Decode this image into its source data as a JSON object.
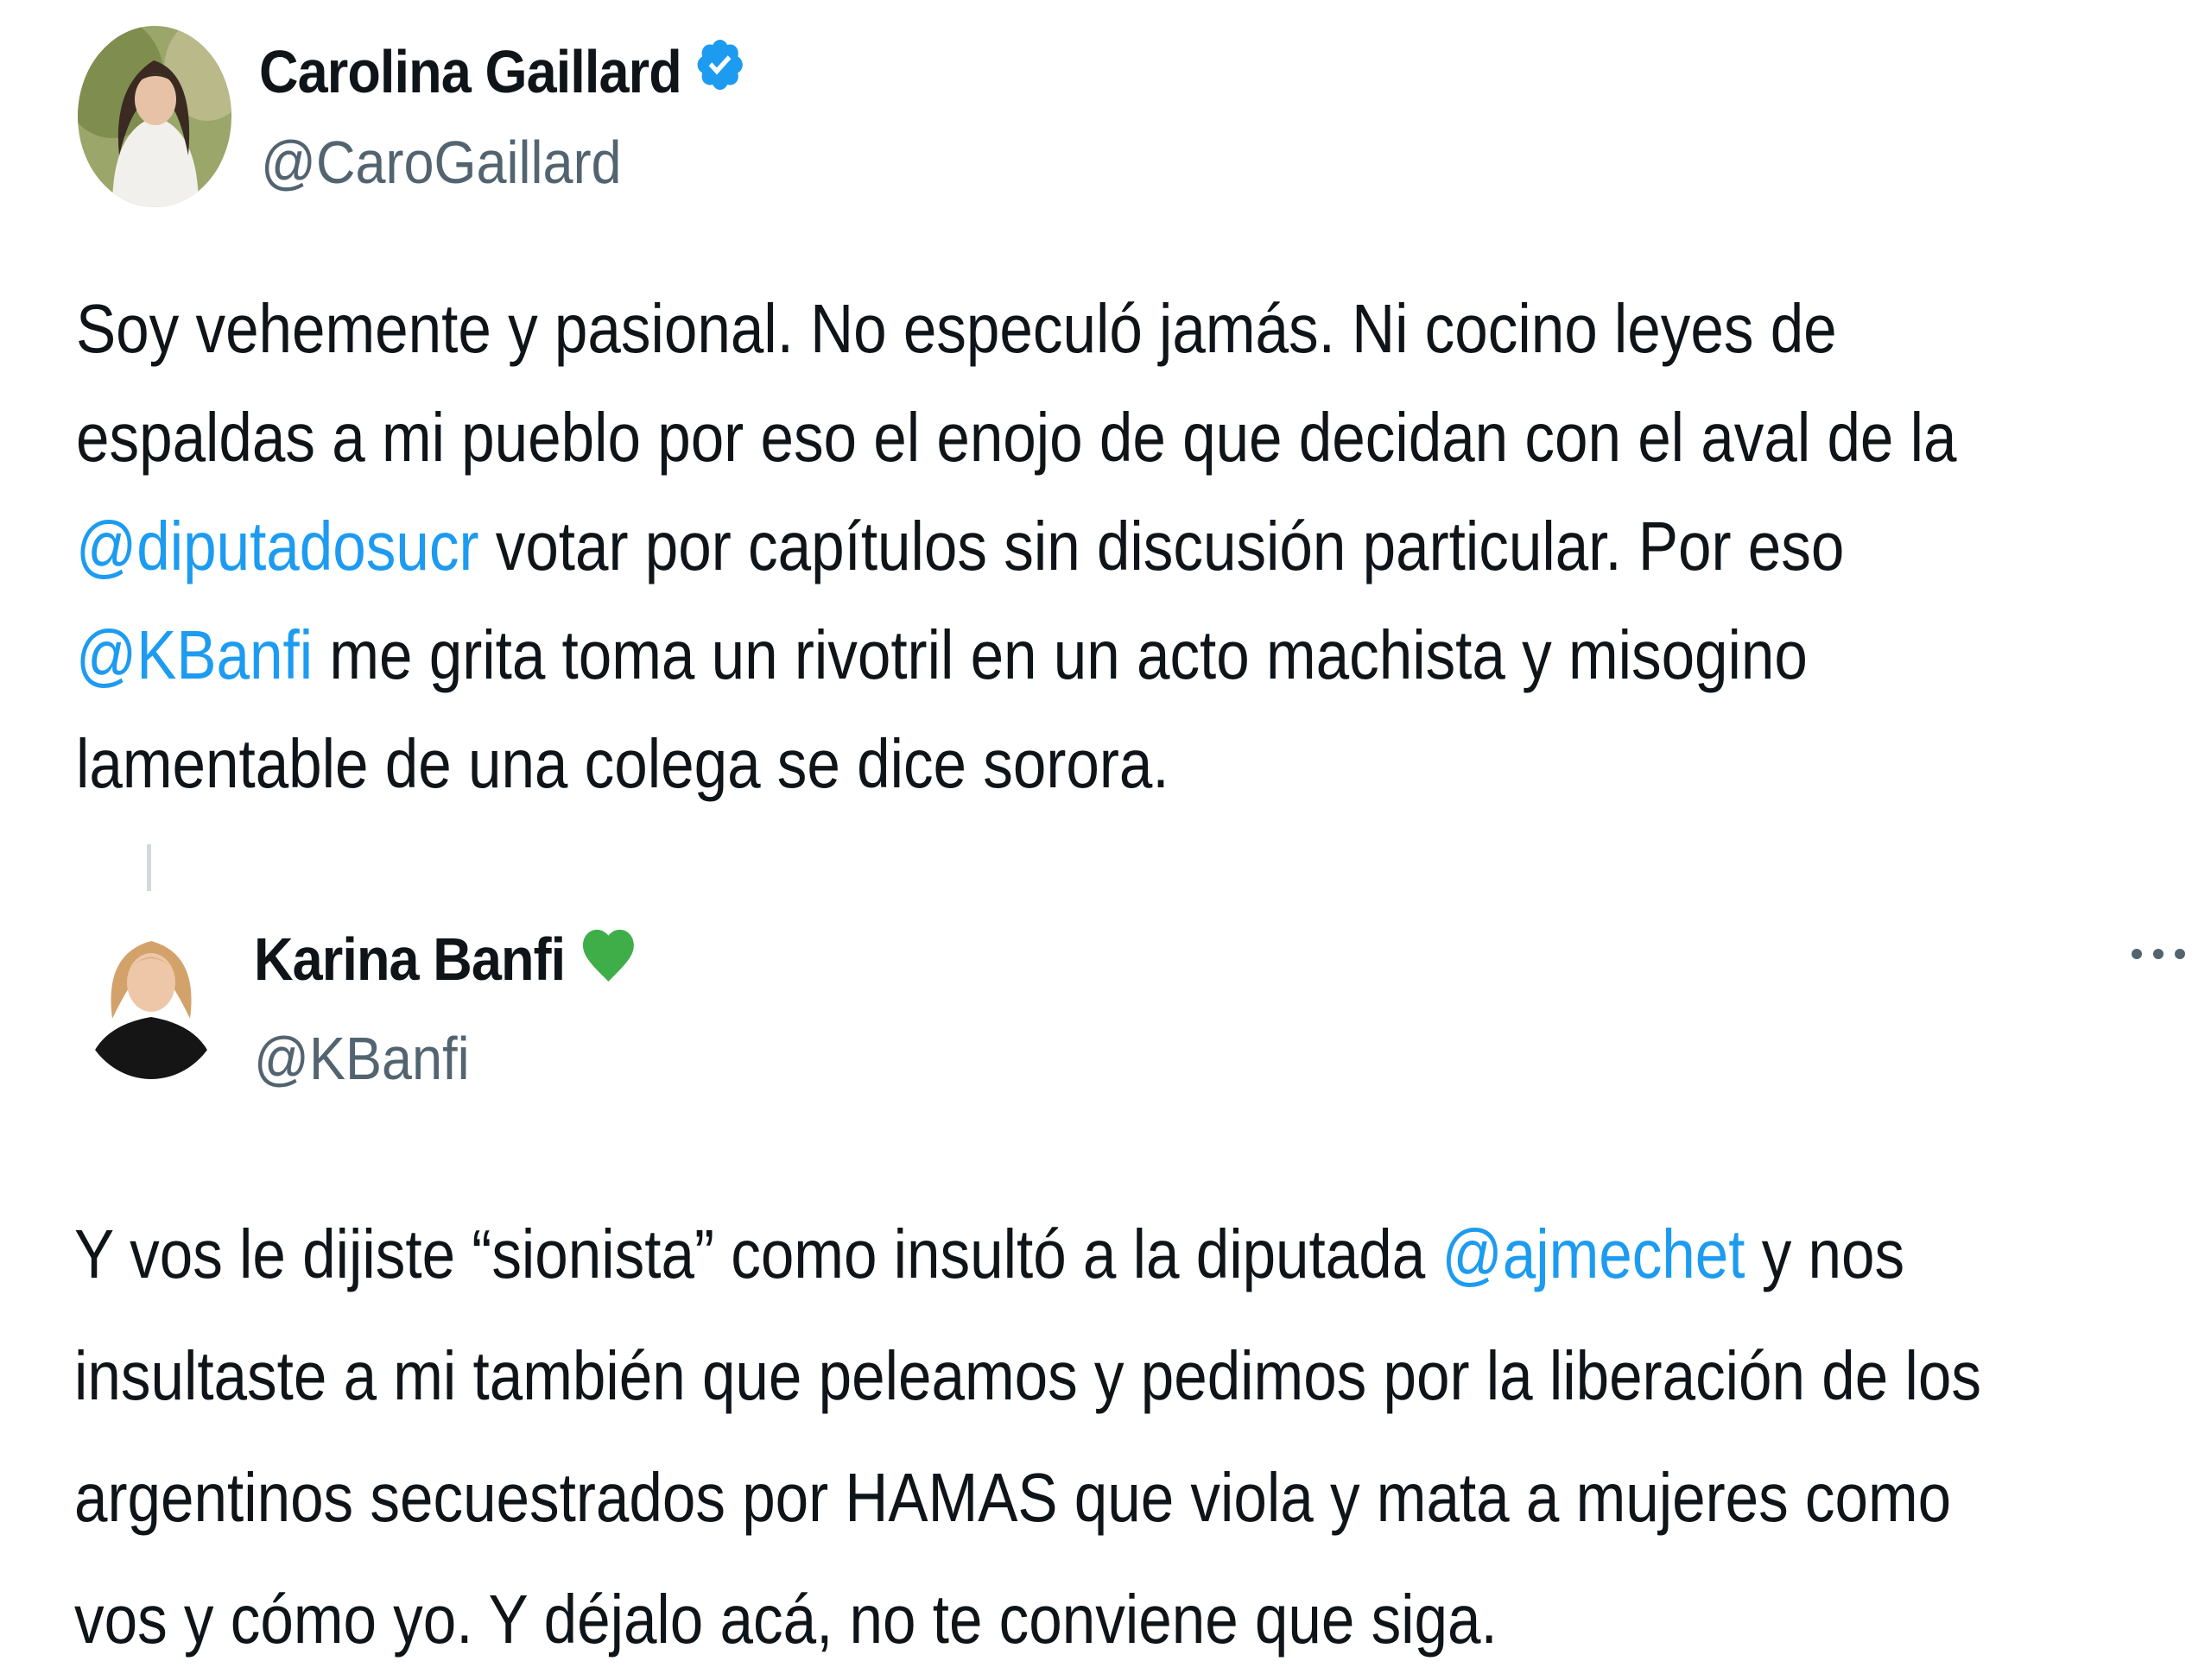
{
  "tweet1": {
    "display_name": "Carolina Gaillard",
    "handle": "@CaroGaillard",
    "badge": "verified-badge-icon",
    "lines": [
      [
        {
          "t": "Soy vehemente y pasional. No especuló jamás. Ni cocino leyes de"
        }
      ],
      [
        {
          "t": "espaldas a mi pueblo por eso el enojo de que decidan con el aval de la"
        }
      ],
      [
        {
          "t": "@diputadosucr",
          "m": true
        },
        {
          "t": " votar por capítulos sin discusión particular. Por eso"
        }
      ],
      [
        {
          "t": "@KBanfi",
          "m": true
        },
        {
          "t": " me grita toma un rivotril en un acto machista y misogino"
        }
      ],
      [
        {
          "t": "lamentable de una colega se dice sorora."
        }
      ]
    ]
  },
  "tweet2": {
    "display_name": "Karina Banfi",
    "handle": "@KBanfi",
    "badge": "green-heart-icon",
    "more": "more-options-icon",
    "lines": [
      [
        {
          "t": "Y vos le dijiste “sionista” como insultó a la diputada "
        },
        {
          "t": "@ajmechet",
          "m": true
        },
        {
          "t": " y nos"
        }
      ],
      [
        {
          "t": "insultaste a mi también que peleamos y pedimos por la liberación de los"
        }
      ],
      [
        {
          "t": "argentinos secuestrados por HAMAS que viola y mata a mujeres como"
        }
      ],
      [
        {
          "t": "vos y cómo yo. Y déjalo acá, no te conviene que siga."
        }
      ]
    ]
  },
  "colors": {
    "mention": "#1d9bf0",
    "verified": "#1d9bf0",
    "heart": "#3fae49",
    "secondary_text": "#536471"
  }
}
